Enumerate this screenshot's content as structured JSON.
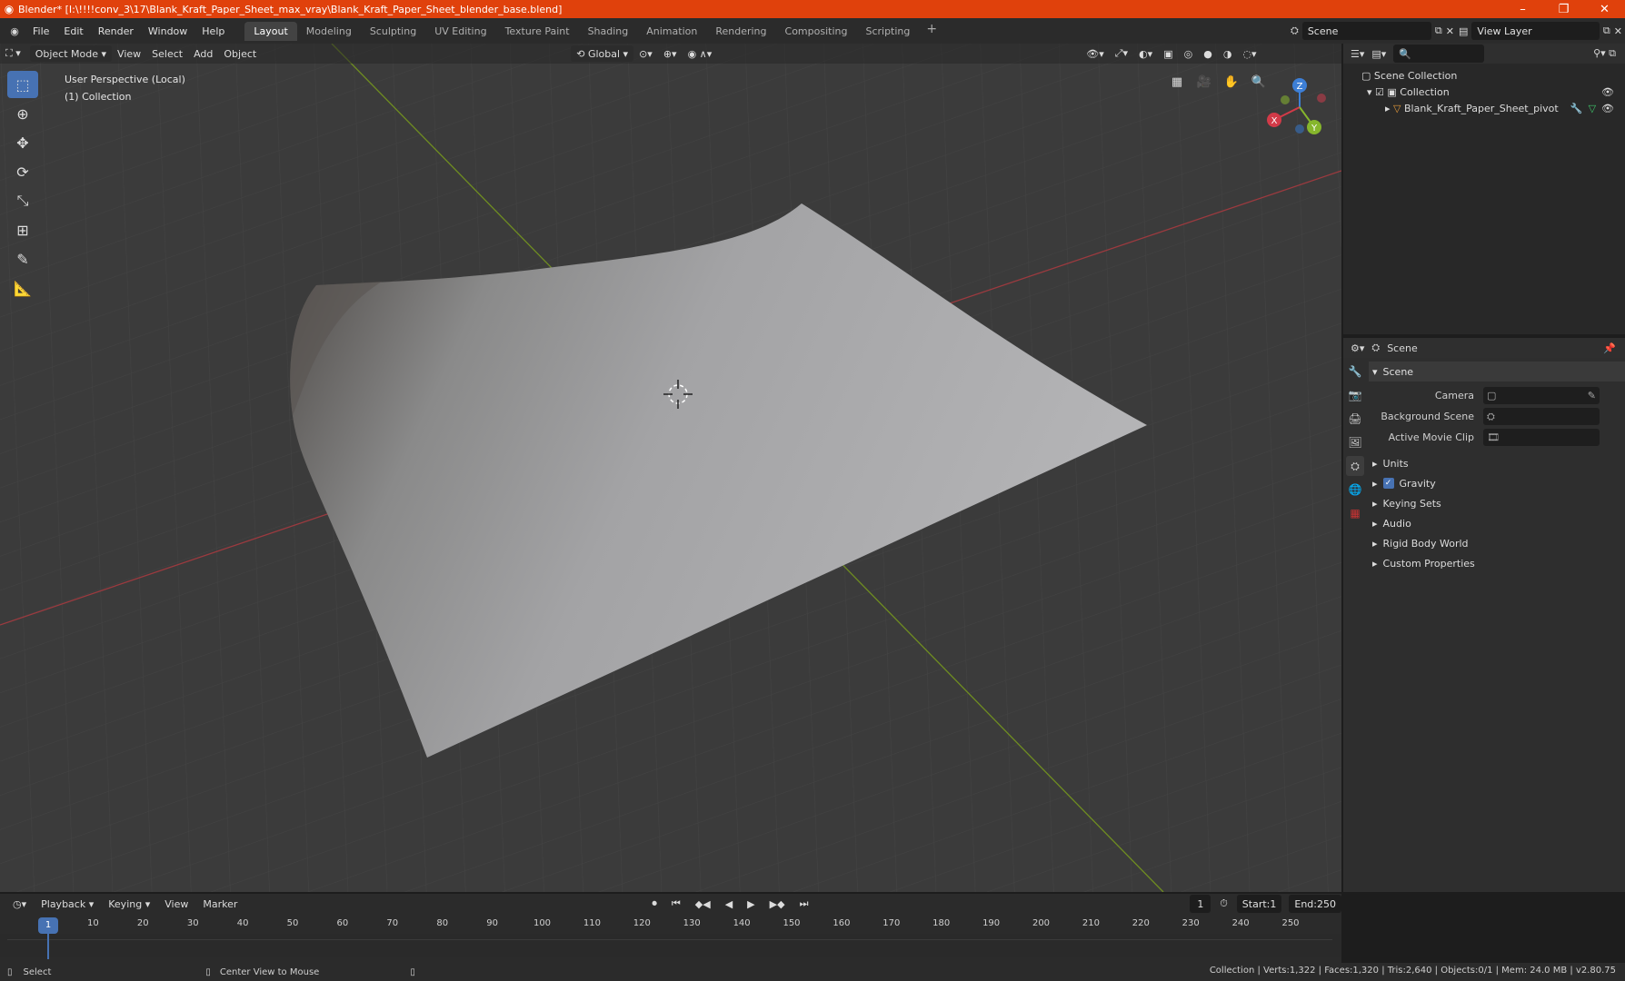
{
  "window": {
    "title": "Blender* [I:\\!!!!conv_3\\17\\Blank_Kraft_Paper_Sheet_max_vray\\Blank_Kraft_Paper_Sheet_blender_base.blend]",
    "minimize": "–",
    "maximize": "❐",
    "close": "✕"
  },
  "menu": [
    "File",
    "Edit",
    "Render",
    "Window",
    "Help"
  ],
  "workspaces": [
    "Layout",
    "Modeling",
    "Sculpting",
    "UV Editing",
    "Texture Paint",
    "Shading",
    "Animation",
    "Rendering",
    "Compositing",
    "Scripting"
  ],
  "workspace_add": "+",
  "scene": {
    "name": "Scene"
  },
  "view_layer": {
    "name": "View Layer"
  },
  "viewport": {
    "mode": "Object Mode",
    "menus": [
      "View",
      "Select",
      "Add",
      "Object"
    ],
    "transform_orientation": "Global",
    "perspective_label": "User Perspective (Local)",
    "collection_label": "(1) Collection",
    "axes": {
      "x": "X",
      "y": "Y",
      "z": "Z"
    }
  },
  "outliner": {
    "root": "Scene Collection",
    "collection": "Collection",
    "object": "Blank_Kraft_Paper_Sheet_pivot"
  },
  "properties": {
    "header": "Scene",
    "panel_title": "Scene",
    "camera_label": "Camera",
    "background_scene_label": "Background Scene",
    "active_movie_clip_label": "Active Movie Clip",
    "subpanels": [
      "Units",
      "Gravity",
      "Keying Sets",
      "Audio",
      "Rigid Body World",
      "Custom Properties"
    ]
  },
  "timeline": {
    "menus": [
      "Playback",
      "Keying",
      "View",
      "Marker"
    ],
    "current_frame": "1",
    "start_label": "Start:",
    "start_value": "1",
    "end_label": "End:",
    "end_value": "250",
    "ticks": [
      "1",
      "10",
      "20",
      "30",
      "40",
      "50",
      "60",
      "70",
      "80",
      "90",
      "100",
      "110",
      "120",
      "130",
      "140",
      "150",
      "160",
      "170",
      "180",
      "190",
      "200",
      "210",
      "220",
      "230",
      "240",
      "250"
    ]
  },
  "statusbar": {
    "select": "Select",
    "center_view": "Center View to Mouse",
    "stats": "Collection | Verts:1,322 | Faces:1,320 | Tris:2,640 | Objects:0/1 | Mem: 24.0 MB | v2.80.75"
  },
  "colors": {
    "accent": "#4772b3",
    "titlebar": "#e0410c",
    "axis_x": "#b5373f",
    "axis_y": "#7ea422"
  }
}
